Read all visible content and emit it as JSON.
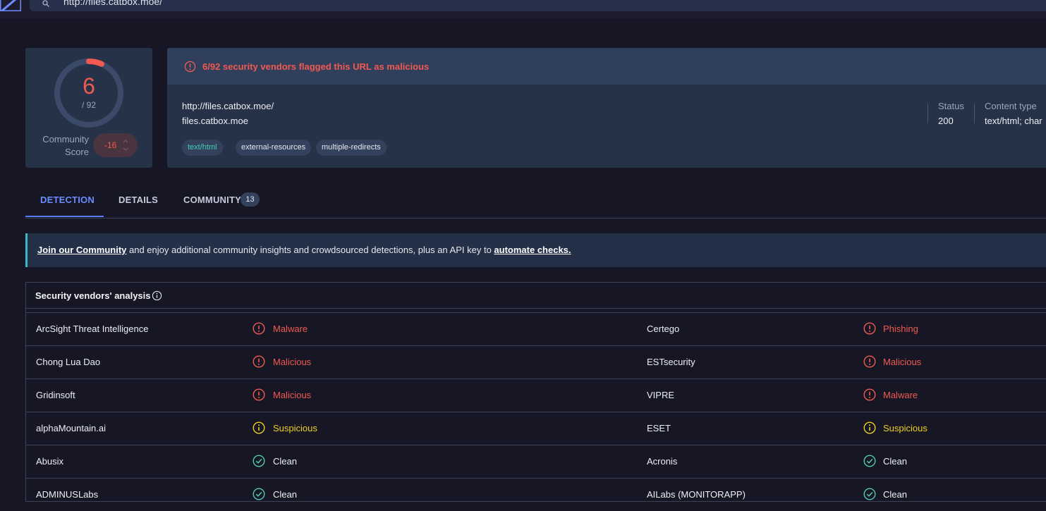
{
  "search": {
    "value": "http://files.catbox.moe/"
  },
  "colors": {
    "malicious": "#f05a50",
    "suspicious": "#f0d020",
    "clean": "#4fc9b0",
    "accent": "#5b7cfa"
  },
  "score": {
    "detections": "6",
    "total": "/ 92",
    "ratio": 0.0652
  },
  "community": {
    "label_line1": "Community",
    "label_line2": "Score",
    "value": "-16"
  },
  "alert": {
    "text": "6/92 security vendors flagged this URL as malicious",
    "icon": "alert-circle-icon"
  },
  "url": {
    "full": "http://files.catbox.moe/",
    "host": "files.catbox.moe"
  },
  "tags": [
    "text/html",
    "external-resources",
    "multiple-redirects"
  ],
  "meta": {
    "status_label": "Status",
    "status_value": "200",
    "content_type_label": "Content type",
    "content_type_value": "text/html; char"
  },
  "tabs": [
    {
      "label": "DETECTION",
      "active": true
    },
    {
      "label": "DETAILS"
    },
    {
      "label": "COMMUNITY",
      "badge": "13"
    }
  ],
  "banner": {
    "link1": "Join our Community",
    "text": " and enjoy additional community insights and crowdsourced detections, plus an API key to ",
    "link2": "automate checks."
  },
  "vendors": {
    "title": "Security vendors' analysis",
    "rows": [
      [
        {
          "name": "ArcSight Threat Intelligence",
          "result": "Malware",
          "status": "malicious"
        },
        {
          "name": "Certego",
          "result": "Phishing",
          "status": "malicious"
        }
      ],
      [
        {
          "name": "Chong Lua Dao",
          "result": "Malicious",
          "status": "malicious"
        },
        {
          "name": "ESTsecurity",
          "result": "Malicious",
          "status": "malicious"
        }
      ],
      [
        {
          "name": "Gridinsoft",
          "result": "Malicious",
          "status": "malicious"
        },
        {
          "name": "VIPRE",
          "result": "Malware",
          "status": "malicious"
        }
      ],
      [
        {
          "name": "alphaMountain.ai",
          "result": "Suspicious",
          "status": "suspicious"
        },
        {
          "name": "ESET",
          "result": "Suspicious",
          "status": "suspicious"
        }
      ],
      [
        {
          "name": "Abusix",
          "result": "Clean",
          "status": "clean"
        },
        {
          "name": "Acronis",
          "result": "Clean",
          "status": "clean"
        }
      ],
      [
        {
          "name": "ADMINUSLabs",
          "result": "Clean",
          "status": "clean"
        },
        {
          "name": "AILabs (MONITORAPP)",
          "result": "Clean",
          "status": "clean"
        }
      ]
    ]
  }
}
